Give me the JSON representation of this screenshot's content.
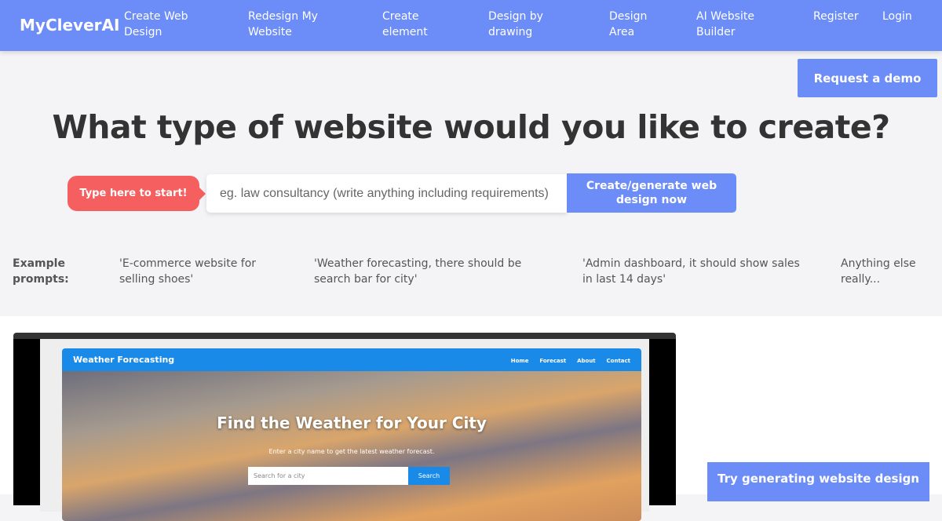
{
  "nav": {
    "logo": "MyCleverAI",
    "links": [
      "Create Web Design",
      "Redesign My Website",
      "Create element",
      "Design by drawing",
      "Design Area",
      "AI Website Builder",
      "Register",
      "Login"
    ]
  },
  "demo_button": "Request a demo",
  "hero": {
    "title": "What type of website would you like to create?",
    "tag": "Type here to start!",
    "placeholder": "eg. law consultancy (write anything including requirements)",
    "generate": "Create/generate web design now"
  },
  "examples": {
    "label": "Example prompts:",
    "items": [
      "'E-commerce website for selling shoes'",
      "'Weather forecasting, there should be search bar for city'",
      "'Admin dashboard, it should show sales in last 14 days'",
      "Anything else really..."
    ]
  },
  "preview": {
    "brand": "Weather Forecasting",
    "links": [
      "Home",
      "Forecast",
      "About",
      "Contact"
    ],
    "title": "Find the Weather for Your City",
    "subtitle": "Enter a city name to get the latest weather forecast.",
    "search_placeholder": "Search for a city",
    "search_button": "Search"
  },
  "try_button": "Try generating website design"
}
